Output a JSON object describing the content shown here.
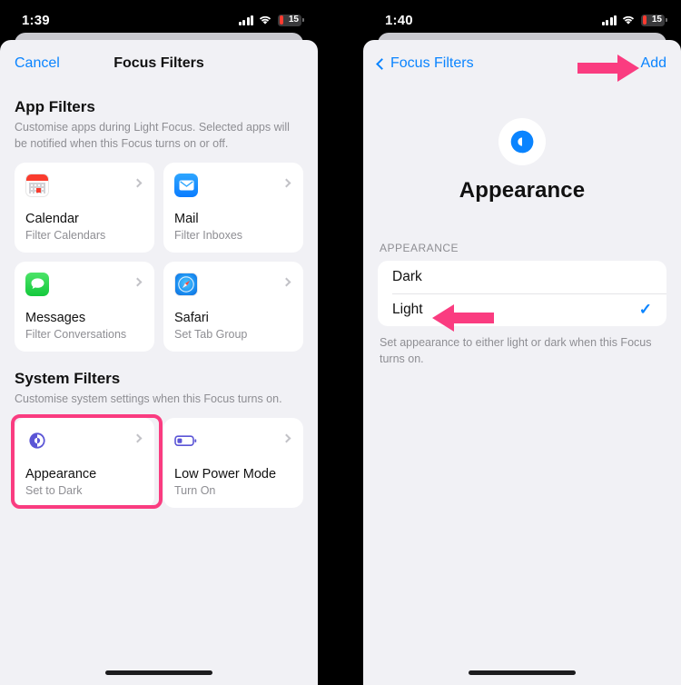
{
  "left_phone": {
    "status_bar": {
      "time": "1:39",
      "cellular_icon": "cellular-bars-icon",
      "wifi_icon": "wifi-icon",
      "battery_level": "15"
    },
    "nav": {
      "cancel_label": "Cancel",
      "title": "Focus Filters"
    },
    "app_filters": {
      "heading": "App Filters",
      "description": "Customise apps during Light Focus. Selected apps will be notified when this Focus turns on or off.",
      "cards": [
        {
          "icon": "calendar-app-icon",
          "name": "Calendar",
          "desc": "Filter Calendars",
          "chevron": "chevron-right-icon"
        },
        {
          "icon": "mail-app-icon",
          "name": "Mail",
          "desc": "Filter Inboxes",
          "chevron": "chevron-right-icon"
        },
        {
          "icon": "messages-app-icon",
          "name": "Messages",
          "desc": "Filter Conversations",
          "chevron": "chevron-right-icon"
        },
        {
          "icon": "safari-app-icon",
          "name": "Safari",
          "desc": "Set Tab Group",
          "chevron": "chevron-right-icon"
        }
      ]
    },
    "system_filters": {
      "heading": "System Filters",
      "description": "Customise system settings when this Focus turns on.",
      "cards": [
        {
          "icon": "appearance-icon",
          "name": "Appearance",
          "desc": "Set to Dark",
          "chevron": "chevron-right-icon",
          "highlighted": true
        },
        {
          "icon": "low-power-mode-icon",
          "name": "Low Power Mode",
          "desc": "Turn On",
          "chevron": "chevron-right-icon",
          "highlighted": false
        }
      ]
    }
  },
  "right_phone": {
    "status_bar": {
      "time": "1:40",
      "cellular_icon": "cellular-bars-icon",
      "wifi_icon": "wifi-icon",
      "battery_level": "15"
    },
    "nav": {
      "back_label": "Focus Filters",
      "add_label": "Add"
    },
    "hero": {
      "icon": "appearance-icon",
      "title": "Appearance"
    },
    "group_label": "APPEARANCE",
    "options": [
      {
        "label": "Dark",
        "selected": false
      },
      {
        "label": "Light",
        "selected": true,
        "check_icon": "checkmark-icon"
      }
    ],
    "footnote": "Set appearance to either light or dark when this Focus turns on.",
    "annotations": [
      {
        "name": "arrow-to-add",
        "points_to": "Add"
      },
      {
        "name": "arrow-to-light",
        "points_to": "Light"
      }
    ]
  },
  "colors": {
    "accent_blue": "#0a84ff",
    "annotation_pink": "#fa3c80",
    "appearance_purple": "#5b55d6",
    "appearance_blue": "#0a84ff",
    "sheet_bg": "#f1f1f5"
  }
}
